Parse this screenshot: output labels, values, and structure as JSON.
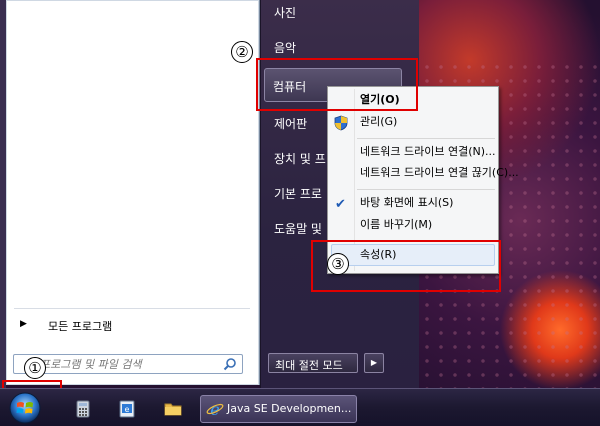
{
  "start_menu": {
    "right_items": {
      "pictures": "사진",
      "music": "음악",
      "computer": "컴퓨터",
      "control_panel": "제어판",
      "devices": "장치 및 프",
      "default_programs": "기본 프로",
      "help": "도움말 및"
    },
    "all_programs": "모든 프로그램",
    "search_placeholder": "프로그램 및 파일 검색",
    "shutdown_label": "최대 절전 모드"
  },
  "context_menu": {
    "open": "열기(O)",
    "manage": "관리(G)",
    "map_drive": "네트워크 드라이브 연결(N)...",
    "disconnect_drive": "네트워크 드라이브 연결 끊기(C)...",
    "show_desktop": "바탕 화면에 표시(S)",
    "rename": "이름 바꾸기(M)",
    "properties": "속성(R)"
  },
  "callouts": {
    "step1": "①",
    "step2": "②",
    "step3": "③"
  },
  "taskbar": {
    "active_window": "Java SE Developmen..."
  },
  "icons": {
    "search": "search-icon",
    "shield": "shield-icon",
    "check": "check-icon",
    "start": "windows-orb-icon",
    "calculator": "calculator-icon",
    "program": "program-icon",
    "folder": "folder-icon",
    "ie": "internet-explorer-icon"
  },
  "colors": {
    "highlight_red": "#e00000",
    "taskbar": "#1c1830"
  }
}
